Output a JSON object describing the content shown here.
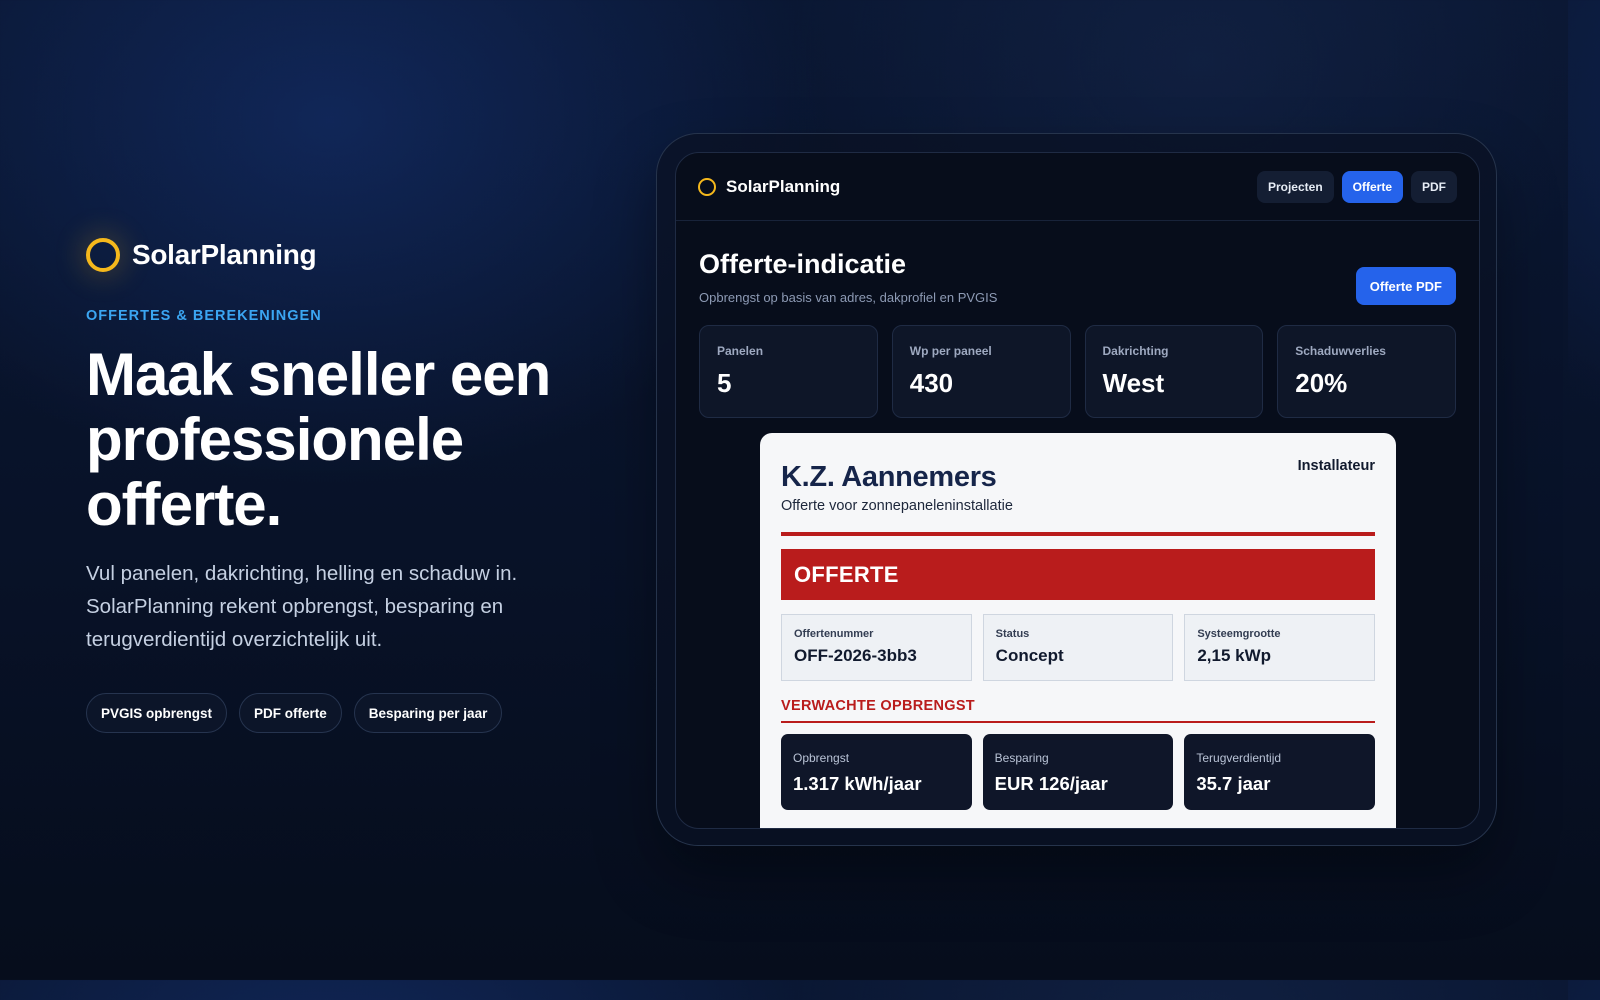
{
  "hero": {
    "brand": "SolarPlanning",
    "eyebrow": "OFFERTES & BEREKENINGEN",
    "headline_lines": [
      "Maak sneller een",
      "professionele",
      "offerte."
    ],
    "lede_lines": [
      "Vul panelen, dakrichting, helling en schaduw in.",
      "SolarPlanning rekent opbrengst, besparing en",
      "terugverdientijd overzichtelijk uit."
    ],
    "chips": [
      "PVGIS opbrengst",
      "PDF offerte",
      "Besparing per jaar"
    ]
  },
  "app": {
    "brand": "SolarPlanning",
    "nav": [
      "Projecten",
      "Offerte",
      "PDF"
    ],
    "active_nav": "Offerte",
    "title": "Offerte-indicatie",
    "subtitle": "Opbrengst op basis van adres, dakprofiel en PVGIS",
    "pdf_button": "Offerte PDF",
    "stats": [
      {
        "label": "Panelen",
        "value": "5"
      },
      {
        "label": "Wp per paneel",
        "value": "430"
      },
      {
        "label": "Dakrichting",
        "value": "West"
      },
      {
        "label": "Schaduwverlies",
        "value": "20%"
      }
    ]
  },
  "quote": {
    "installer_label": "Installateur",
    "company": "K.Z. Aannemers",
    "subtitle": "Offerte voor zonnepaneleninstallatie",
    "banner": "OFFERTE",
    "meta": [
      {
        "label": "Offertenummer",
        "value": "OFF-2026-3bb3"
      },
      {
        "label": "Status",
        "value": "Concept"
      },
      {
        "label": "Systeemgrootte",
        "value": "2,15 kWp"
      }
    ],
    "section_title": "VERWACHTE OPBRENGST",
    "results": [
      {
        "label": "Opbrengst",
        "value": "1.317 kWh/jaar"
      },
      {
        "label": "Besparing",
        "value": "EUR 126/jaar"
      },
      {
        "label": "Terugverdientijd",
        "value": "35.7 jaar"
      }
    ]
  },
  "colors": {
    "accent_blue": "#2563eb",
    "eyebrow_blue": "#3ba6f2",
    "sun_yellow": "#f5b81c",
    "quote_red": "#b91c1c",
    "background": "#081228"
  },
  "icons": [
    "sun-ring-icon"
  ]
}
